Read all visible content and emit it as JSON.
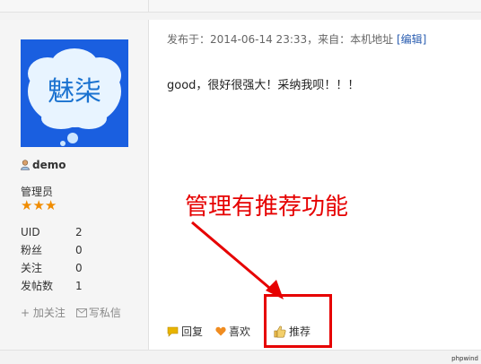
{
  "author": {
    "avatar_text": "魅柒",
    "username": "demo",
    "role": "管理员",
    "stars": "★★★",
    "stats": [
      {
        "label": "UID",
        "value": "2"
      },
      {
        "label": "粉丝",
        "value": "0"
      },
      {
        "label": "关注",
        "value": "0"
      },
      {
        "label": "发帖数",
        "value": "1"
      }
    ],
    "follow_label": "+ 加关注",
    "message_label": "写私信"
  },
  "post": {
    "meta_prefix": "发布于：2014-06-14 23:33，来自：本机地址 ",
    "edit_label": "[编辑]",
    "body": "good，很好很强大！采纳我呗！！！",
    "actions": {
      "reply": "回复",
      "like": "喜欢",
      "recommend": "推荐"
    }
  },
  "annotation": "管理有推荐功能",
  "watermark": "phpwind",
  "colors": {
    "annotation": "#e60000",
    "star": "#f08c00",
    "link": "#2a5db0"
  }
}
